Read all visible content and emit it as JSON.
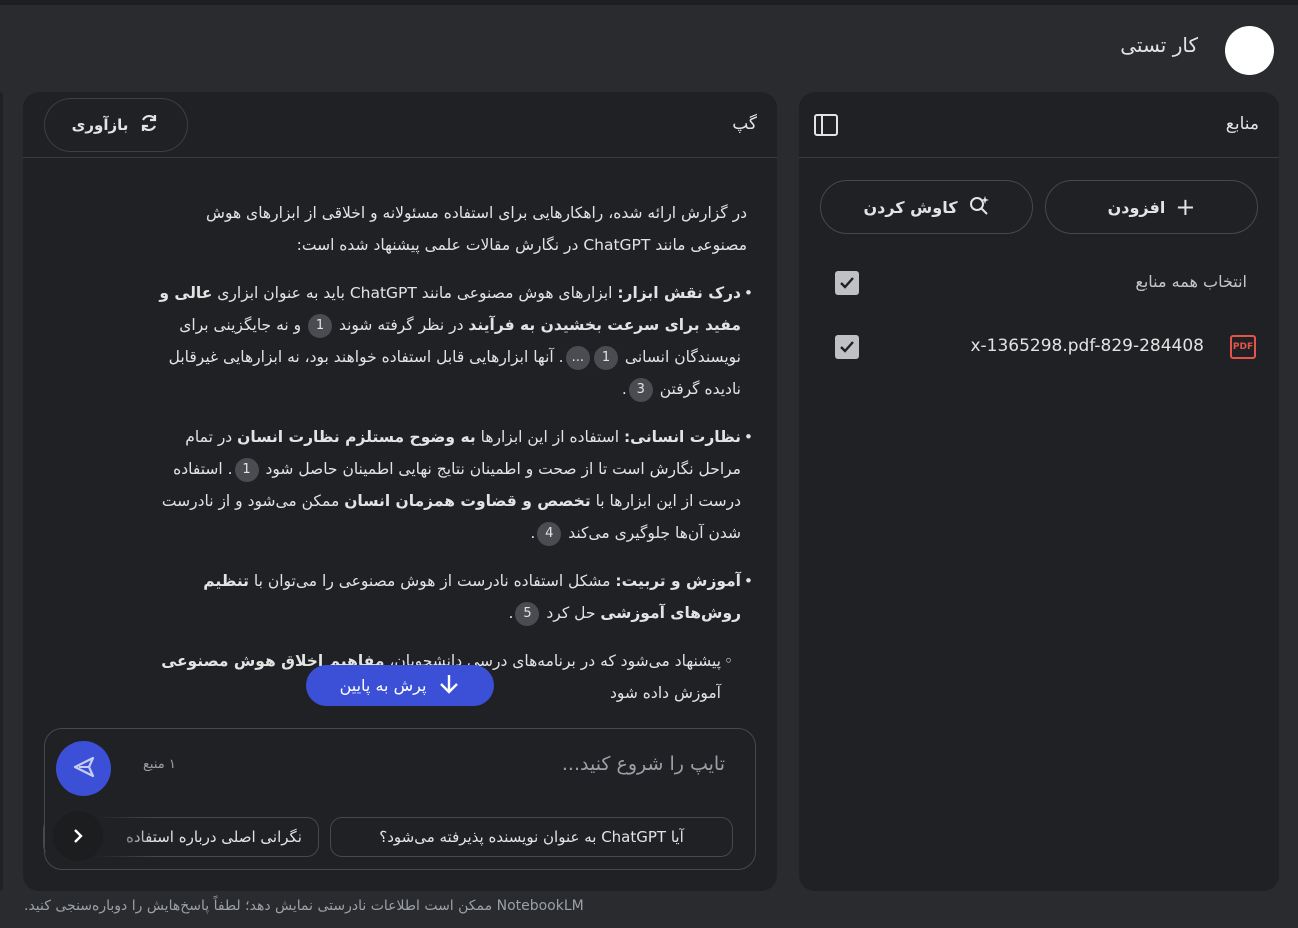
{
  "header": {
    "title": "کار تستی"
  },
  "sources": {
    "title": "منابع",
    "add_label": "افزودن",
    "discover_label": "کاوش کردن",
    "select_all_label": "انتخاب همه منابع",
    "files": [
      {
        "name": "x-1365298.pdf-829-284408",
        "icon": "pdf-icon",
        "checked": true
      }
    ]
  },
  "chat": {
    "title": "گپ",
    "refresh_label": "بازآوری",
    "intro": "در گزارش ارائه شده، راهکارهایی برای استفاده مسئولانه و اخلاقی از ابزارهای هوش مصنوعی مانند ChatGPT در نگارش مقالات علمی پیشنهاد شده است:",
    "b1": {
      "lead": "درک نقش ابزار:",
      "t1": " ابزارهای هوش مصنوعی مانند ChatGPT باید به عنوان ابزاری ",
      "s1": "عالی و مفید برای سرعت بخشیدن به فرآیند",
      "t2": " در نظر گرفته شوند ",
      "c1": "1",
      "t3": " و نه جایگزینی برای نویسندگان انسانی ",
      "c2": "1",
      "c3": "...",
      "t4": ". آنها ابزارهایی قابل استفاده خواهند بود، نه ابزارهایی غیرقابل نادیده گرفتن ",
      "c4": "3",
      "t5": "."
    },
    "b2": {
      "lead": "نظارت انسانی:",
      "t1": " استفاده از این ابزارها ",
      "s1": "به وضوح مستلزم نظارت انسان",
      "t2": " در تمام مراحل نگارش است تا از صحت و اطمینان نتایج نهایی اطمینان حاصل شود ",
      "c1": "1",
      "t3": ". استفاده درست از این ابزارها با ",
      "s2": "تخصص و قضاوت همزمان انسان",
      "t4": " ممکن می‌شود و از نادرست شدن آن‌ها جلوگیری می‌کند ",
      "c2": "4",
      "t5": "."
    },
    "b3": {
      "lead": "آموزش و تربیت:",
      "t1": " مشکل استفاده نادرست از هوش مصنوعی را می‌توان با ",
      "s1": "تنظیم روش‌های آموزشی",
      "t2": " حل کرد ",
      "c1": "5",
      "t3": "."
    },
    "b4": {
      "t1": "پیشنهاد می‌شود که در برنامه‌های درسی دانشجویان، ",
      "s1": "مفاهیم اخلاق هوش مصنوعی",
      "t2": " آموزش داده شود"
    },
    "jump_label": "پرش به پایین",
    "input_placeholder": "تایپ را شروع کنید...",
    "source_count": "۱ منبع",
    "suggestions": [
      "آیا ChatGPT به عنوان نویسنده پذیرفته می‌شود؟",
      "نگرانی اصلی درباره استفاده"
    ]
  },
  "footer": {
    "note": "NotebookLM ممکن است اطلاعات نادرستی نمایش دهد؛ لطفاً پاسخ‌هایش را دوباره‌سنجی کنید."
  },
  "colors": {
    "accent": "#3b50d6",
    "panel": "#202124",
    "background": "#2a2b2e"
  }
}
